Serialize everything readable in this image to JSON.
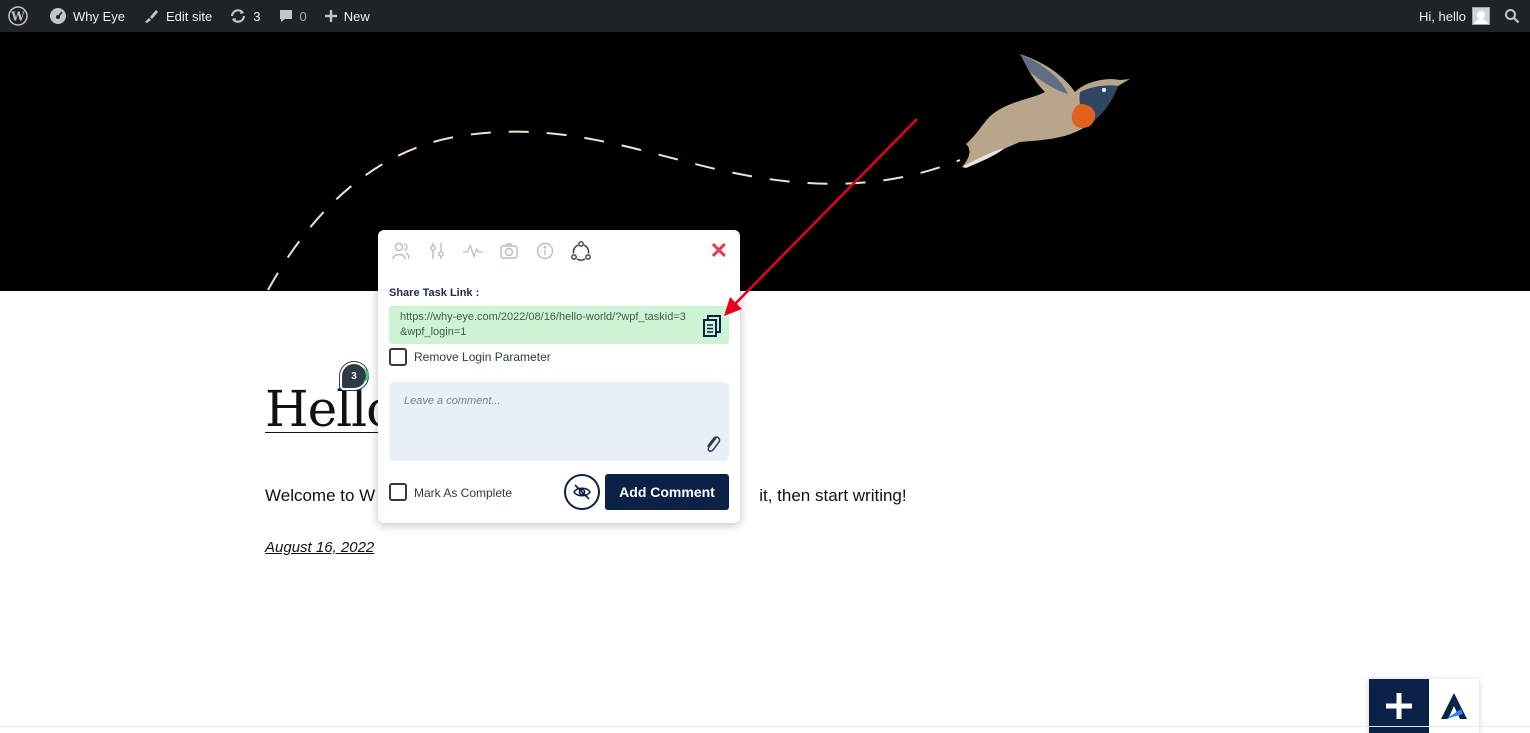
{
  "adminbar": {
    "site_name": "Why Eye",
    "edit_site": "Edit site",
    "updates_count": "3",
    "comments_count": "0",
    "new_label": "New",
    "greeting": "Hi, hello"
  },
  "post": {
    "title": "Hello",
    "excerpt_left": "Welcome to W",
    "excerpt_right": "it, then start writing!",
    "date": "August 16, 2022"
  },
  "pin": {
    "number": "3"
  },
  "popup": {
    "tabs": [
      "users-icon",
      "settings-sliders-icon",
      "activity-icon",
      "camera-icon",
      "info-icon",
      "share-icon"
    ],
    "share_label": "Share Task Link :",
    "share_url": "https://why-eye.com/2022/08/16/hello-world/?wpf_taskid=3&wpf_login=1",
    "remove_login_label": "Remove Login Parameter",
    "comment_placeholder": "Leave a comment...",
    "mark_complete_label": "Mark As Complete",
    "add_comment_label": "Add Comment"
  },
  "colors": {
    "adminbar_bg": "#1d2327",
    "primary_navy": "#0b2148",
    "share_box_bg": "#ccf4d4",
    "close_red": "#e8384f",
    "annotation_arrow": "#e8001c"
  }
}
